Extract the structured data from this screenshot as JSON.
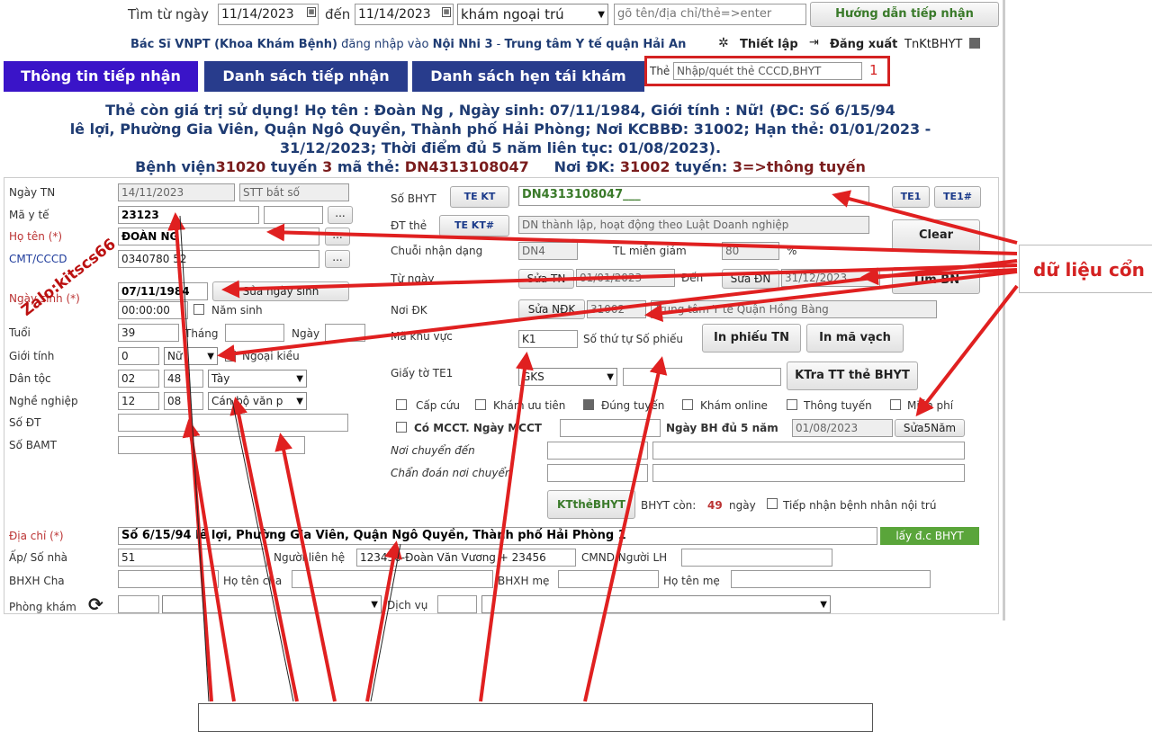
{
  "search": {
    "from_label": "Tìm từ ngày",
    "from_date": "11/14/2023",
    "to_label": "đến",
    "to_date": "11/14/2023",
    "visit_type": "khám ngoại trú",
    "query_placeholder": "gõ tên/địa chỉ/thẻ=>enter",
    "guide_button": "Hướng dẫn tiếp nhận"
  },
  "userbar": {
    "user": "Bác Sĩ VNPT (Khoa Khám Bệnh)",
    "login_text": "đăng nhập vào",
    "dept": "Nội Nhi 3",
    "sep": "-",
    "center": "Trung tâm Y tế quận Hải An",
    "settings": "Thiết lập",
    "logout": "Đăng xuất",
    "account": "TnKtBHYT"
  },
  "tabs": {
    "t1": "Thông tin tiếp nhận",
    "t2": "Danh sách tiếp nhận",
    "t3": "Danh sách hẹn tái khám"
  },
  "card_input": {
    "label": "Thẻ",
    "placeholder": "Nhập/quét thẻ CCCD,BHYT",
    "marker": "1"
  },
  "info": {
    "line1": "Thẻ còn giá trị sử dụng! Họ tên : Đoàn Ng          , Ngày sinh: 07/11/1984, Giới tính : Nữ! (ĐC: Số 6/15/94",
    "line2": "lê lợi, Phường Gia Viên, Quận Ngô Quyền, Thành phố Hải Phòng; Nơi KCBBĐ: 31002; Hạn thẻ: 01/01/2023 -",
    "line3": "31/12/2023; Thời điểm đủ 5 năm liên tục: 01/08/2023).",
    "hosp_label": "Bệnh viện",
    "hosp_code": "31020",
    "route_label": "tuyến",
    "route": "3",
    "card_label": "mã thẻ:",
    "card_code": "DN4313108047",
    "reg_label": "Nơi ĐK:",
    "reg_code": "31002",
    "route2_label": "tuyến:",
    "route2": "3=>thông tuyến"
  },
  "left": {
    "ngay_tn_label": "Ngày TN",
    "ngay_tn": "14/11/2023",
    "stt_placeholder": "STT bắt số",
    "ma_yte_label": "Mã y tế",
    "ma_yte": "23123",
    "dots": "...",
    "ho_ten_label": "Họ tên (*)",
    "ho_ten": "ĐOÀN NG",
    "cccd_label": "CMT/CCCD",
    "cccd": "0340780 52",
    "ngay_sinh_label": "Ngày sinh (*)",
    "ngay_sinh": "07/11/1984",
    "sua_ngay_sinh": "Sửa ngày sinh",
    "time": "00:00:00",
    "nam_sinh": "Năm sinh",
    "tuoi_label": "Tuổi",
    "tuoi": "39",
    "thang_label": "Tháng",
    "ngay_label": "Ngày",
    "gioi_tinh_label": "Giới tính",
    "gioi_tinh_code": "0",
    "gioi_tinh": "Nữ",
    "ngoai_kieu": "Ngoại kiều",
    "dan_toc_label": "Dân tộc",
    "dan_toc_code": "02",
    "dan_toc_num": "48",
    "dan_toc": "Tày",
    "nghe_label": "Nghề nghiệp",
    "nghe_code": "12",
    "nghe_num": "08",
    "nghe": "Cán bộ văn p",
    "so_dt_label": "Số ĐT",
    "so_bamt_label": "Số BAMT"
  },
  "right": {
    "so_bhyt_label": "Số BHYT",
    "te_kt": "TE KT",
    "so_bhyt": "DN4313108047___",
    "te1": "TE1",
    "te1h": "TE1#",
    "dt_the_label": "ĐT thẻ",
    "te_kth": "TE KT#",
    "dt_the": "DN thành lập, hoạt động theo Luật Doanh nghiệp",
    "clear": "Clear",
    "chuoi_label": "Chuỗi nhận dạng",
    "chuoi": "DN4",
    "tl_label": "TL miễn giảm",
    "tl": "80",
    "pct": "%",
    "tu_ngay_label": "Từ ngày",
    "sua_tn": "Sửa TN",
    "tu_ngay": "01/01/2023",
    "den_label": "Đến",
    "sua_dn": "Sửa ĐN",
    "den_ngay": "31/12/2023",
    "tim_bn": "Tìm BN",
    "noi_dk_label": "Nơi ĐK",
    "sua_ndk": "Sửa NĐK",
    "noi_dk_code": "31002",
    "noi_dk": "Trung tâm Y tế Quận Hồng Bàng",
    "ma_khu_vuc_label": "Mã khu vực",
    "ma_khu_vuc": "K1",
    "stt_phieu_label": "Số thứ tự Số phiếu",
    "in_phieu": "In phiếu TN",
    "in_ma_vach": "In mã vạch",
    "giay_to_label": "Giấy tờ TE1",
    "giay_to": "GKS",
    "ktra": "KTra TT thẻ BHYT",
    "cb_cap_cuu": "Cấp cứu",
    "cb_uu_tien": "Khám ưu tiên",
    "cb_dung_tuyen": "Đúng tuyến",
    "cb_online": "Khám online",
    "cb_thong_tuyen": "Thông tuyến",
    "cb_mien_phi": "Miễn phí",
    "co_mcct": "Có MCCT. Ngày MCCT",
    "ngay_bh5_label": "Ngày BH đủ 5 năm",
    "ngay_bh5": "01/08/2023",
    "sua5nam": "Sửa5Năm",
    "noi_chuyen_label": "Nơi chuyển đến",
    "chan_doan_label": "Chẩn đoán nơi chuyển",
    "kt_the": "KTthẻBHYT",
    "bhyt_con_label": "BHYT còn:",
    "bhyt_con_days": "49",
    "ngay_unit": "ngày",
    "noi_tru": "Tiếp nhận bệnh nhân nội trú"
  },
  "bottom": {
    "dia_chi_label": "Địa chỉ (*)",
    "dia_chi": "Số 6/15/94 lê lợi, Phường Gia Viên, Quận Ngô Quyền, Thành phố Hải Phòng 1",
    "lay_dc": "lấy đ.c BHYT",
    "so_nha_label": "Ấp/ Số nhà",
    "so_nha": "51",
    "nguoi_lh_label": "Người liên hệ",
    "nguoi_lh": "123456-Đoàn Văn Vương + 23456",
    "cmnd_lh_label": "CMND Người LH",
    "bhxh_cha_label": "BHXH Cha",
    "ho_ten_cha_label": "Họ tên cha",
    "bhxh_me_label": "BHXH mẹ",
    "ho_ten_me_label": "Họ tên mẹ",
    "phong_kham_label": "Phòng khám",
    "dich_vu_label": "Dịch vụ"
  },
  "annotation": {
    "text": "dữ liệu cổn",
    "watermark": "Zalo:kitscs66"
  },
  "colors": {
    "tab_active": "#3a14c8",
    "tab": "#283c8c",
    "info": "#1f3c73",
    "red": "#d42222",
    "green_btn": "#5aa53a"
  }
}
